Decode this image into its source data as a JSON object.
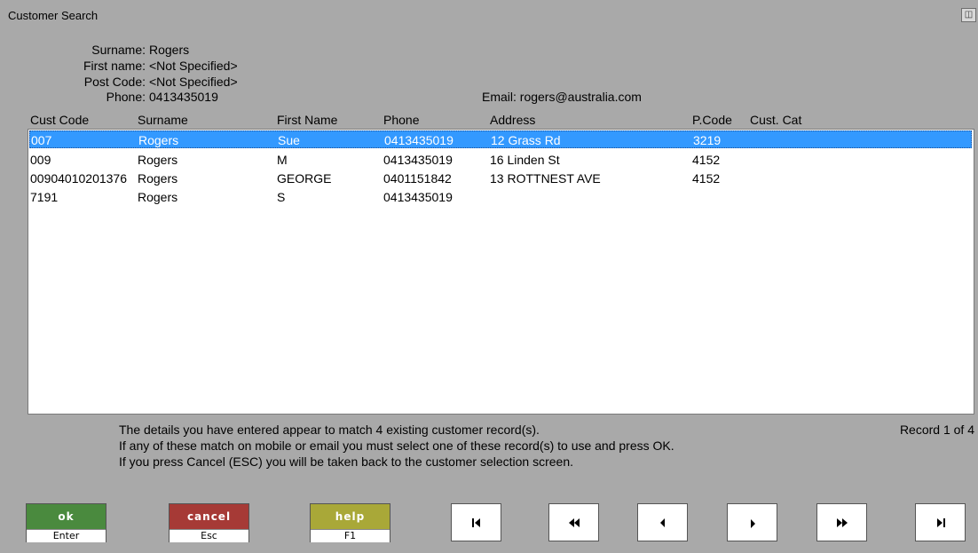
{
  "window": {
    "title": "Customer Search"
  },
  "criteria": {
    "surname_label": "Surname:",
    "surname": "Rogers",
    "firstname_label": "First name:",
    "firstname": "<Not Specified>",
    "postcode_label": "Post Code:",
    "postcode": "<Not Specified>",
    "phone_label": "Phone:",
    "phone": "0413435019",
    "email": "Email: rogers@australia.com"
  },
  "columns": [
    "Cust Code",
    "Surname",
    "First Name",
    "Phone",
    "Address",
    "P.Code",
    "Cust. Cat"
  ],
  "rows": [
    {
      "code": "007",
      "surname": "Rogers",
      "first": "Sue",
      "phone": "0413435019",
      "address": "12 Grass Rd",
      "pcode": "3219",
      "cat": ""
    },
    {
      "code": "009",
      "surname": "Rogers",
      "first": "M",
      "phone": "0413435019",
      "address": "16 Linden St",
      "pcode": "4152",
      "cat": ""
    },
    {
      "code": "00904010201376",
      "surname": "Rogers",
      "first": "GEORGE",
      "phone": "0401151842",
      "address": "13 ROTTNEST AVE",
      "pcode": "4152",
      "cat": ""
    },
    {
      "code": "7191",
      "surname": "Rogers",
      "first": "S",
      "phone": "0413435019",
      "address": "",
      "pcode": "",
      "cat": ""
    }
  ],
  "messages": {
    "line1": "The details you have entered appear to match 4 existing customer record(s).",
    "line2": "If any of these match on mobile or email you must select one of these record(s) to use and press OK.",
    "line3": "If you press Cancel (ESC) you will be taken back to the customer selection screen.",
    "record": "Record 1 of 4"
  },
  "buttons": {
    "ok": {
      "label": "ok",
      "key": "Enter",
      "color": "#4a8a3e"
    },
    "cancel": {
      "label": "cancel",
      "key": "Esc",
      "color": "#a63a36"
    },
    "help": {
      "label": "help",
      "key": "F1",
      "color": "#a9a838"
    }
  },
  "nav_icons": [
    "first-record-icon",
    "previous-page-icon",
    "previous-record-icon",
    "next-record-icon",
    "next-page-icon",
    "last-record-icon"
  ],
  "colors": {
    "selection": "#3399ff",
    "background": "#a9a9a9"
  }
}
